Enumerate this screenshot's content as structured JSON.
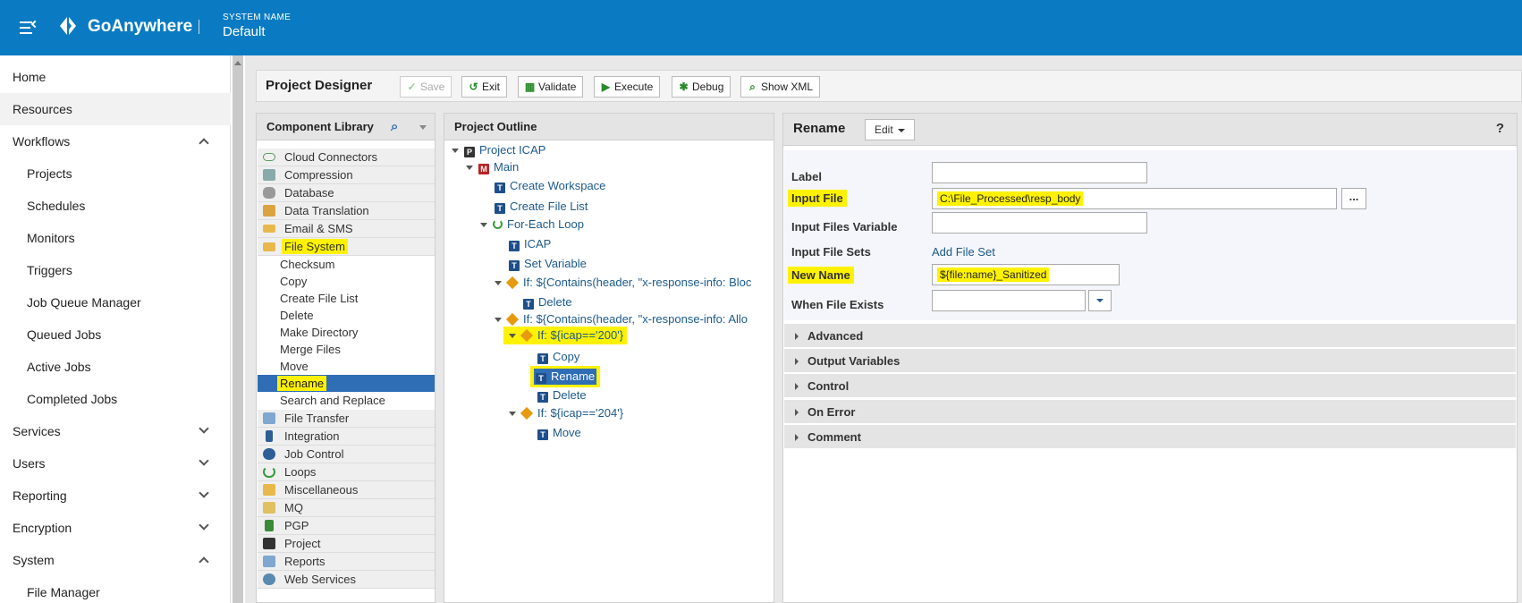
{
  "header": {
    "brand": "GoAnywhere",
    "system_label": "SYSTEM NAME",
    "system_name": "Default",
    "color": "#0a7bc2"
  },
  "nav": {
    "items": [
      {
        "label": "Home"
      },
      {
        "label": "Resources"
      },
      {
        "label": "Workflows"
      },
      {
        "label": "Projects"
      },
      {
        "label": "Schedules"
      },
      {
        "label": "Monitors"
      },
      {
        "label": "Triggers"
      },
      {
        "label": "Job Queue Manager"
      },
      {
        "label": "Queued Jobs"
      },
      {
        "label": "Active Jobs"
      },
      {
        "label": "Completed Jobs"
      },
      {
        "label": "Services"
      },
      {
        "label": "Users"
      },
      {
        "label": "Reporting"
      },
      {
        "label": "Encryption"
      },
      {
        "label": "System"
      },
      {
        "label": "File Manager"
      }
    ]
  },
  "toolbar": {
    "title": "Project Designer",
    "save": "Save",
    "exit": "Exit",
    "validate": "Validate",
    "execute": "Execute",
    "debug": "Debug",
    "show_xml": "Show XML"
  },
  "library": {
    "title": "Component Library",
    "categories": [
      "Cloud Connectors",
      "Compression",
      "Database",
      "Data Translation",
      "Email & SMS",
      "File System",
      "File Transfer",
      "Integration",
      "Job Control",
      "Loops",
      "Miscellaneous",
      "MQ",
      "PGP",
      "Project",
      "Reports",
      "Web Services"
    ],
    "file_system_items": [
      "Checksum",
      "Copy",
      "Create File List",
      "Delete",
      "Make Directory",
      "Merge Files",
      "Move",
      "Rename",
      "Search and Replace"
    ]
  },
  "outline": {
    "title": "Project Outline",
    "nodes": [
      "Project ICAP",
      "Main",
      "Create Workspace",
      "Create File List",
      "For-Each Loop",
      "ICAP",
      "Set Variable",
      "If: ${Contains(header, \"x-response-info: Bloc",
      "Delete",
      "If: ${Contains(header, \"x-response-info: Allo",
      "If: ${icap=='200'}",
      "Copy",
      "Rename",
      "Delete",
      "If: ${icap=='204'}",
      "Move"
    ]
  },
  "properties": {
    "title": "Rename",
    "edit": "Edit",
    "help": "?",
    "label_label": "Label",
    "input_file_label": "Input File",
    "input_file_value": "C:\\File_Processed\\resp_body",
    "dots": "...",
    "input_files_variable_label": "Input Files Variable",
    "input_file_sets_label": "Input File Sets",
    "add_file_set": "Add File Set",
    "new_name_label": "New Name",
    "new_name_value": "${file:name}_Sanitized",
    "when_file_exists_label": "When File Exists",
    "sections": [
      "Advanced",
      "Output Variables",
      "Control",
      "On Error",
      "Comment"
    ]
  },
  "colors": {
    "highlight": "#fff200",
    "selected": "#2f6db5",
    "link": "#1c5a8c"
  }
}
